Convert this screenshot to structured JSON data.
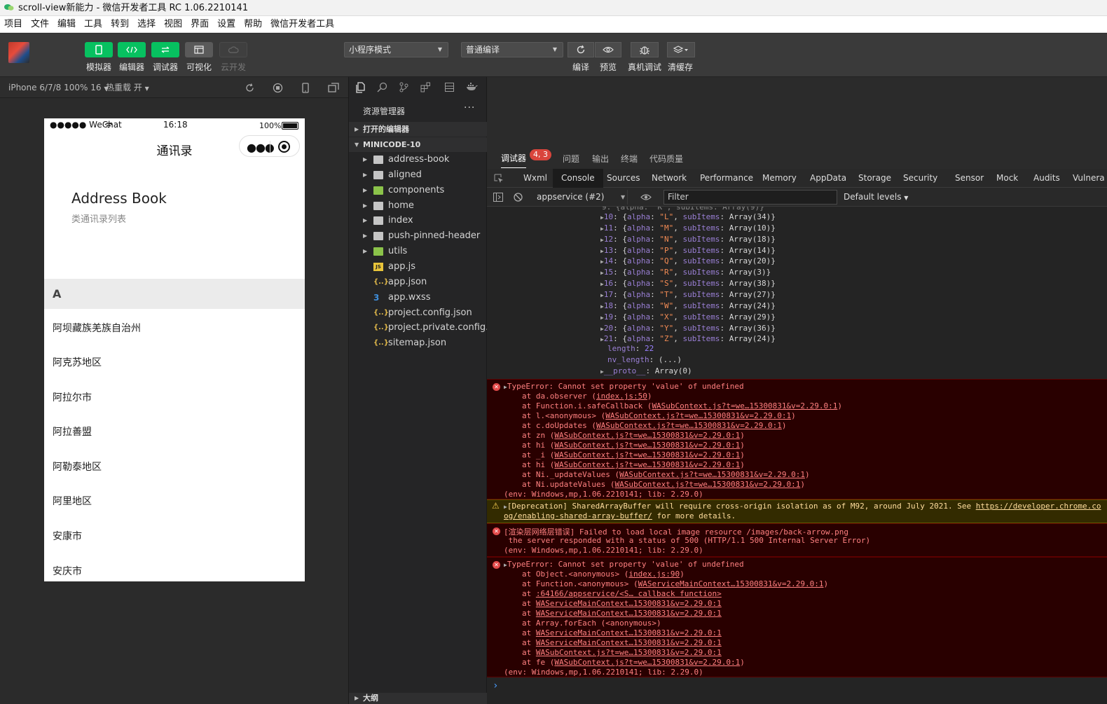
{
  "window": {
    "title": "scroll-view新能力 - 微信开发者工具 RC 1.06.2210141"
  },
  "menu": [
    "项目",
    "文件",
    "编辑",
    "工具",
    "转到",
    "选择",
    "视图",
    "界面",
    "设置",
    "帮助",
    "微信开发者工具"
  ],
  "toolbar": {
    "simulator": "模拟器",
    "editor": "编辑器",
    "debugger": "调试器",
    "visual": "可视化",
    "cloud": "云开发",
    "mode_select": "小程序模式",
    "compile_select": "普通编译",
    "compile": "编译",
    "preview": "预览",
    "real_debug": "真机调试",
    "clear_cache": "清缓存"
  },
  "simulator": {
    "device": "iPhone 6/7/8 100% 16",
    "hot_reload": "热重载 开",
    "status_left": "●●●●● WeChat",
    "time": "16:18",
    "battery": "100%",
    "nav_title": "通讯录",
    "big_title": "Address Book",
    "sub_title": "类通讯录列表",
    "alpha": "A",
    "cities": [
      "阿坝藏族羌族自治州",
      "阿克苏地区",
      "阿拉尔市",
      "阿拉善盟",
      "阿勒泰地区",
      "阿里地区",
      "安康市",
      "安庆市"
    ]
  },
  "explorer": {
    "title": "资源管理器",
    "more": "···",
    "open_editors": "打开的编辑器",
    "project": "MINICODE-10",
    "outline": "大纲",
    "items": [
      {
        "label": "address-book",
        "type": "folder",
        "arrow": true
      },
      {
        "label": "aligned",
        "type": "folder",
        "arrow": true
      },
      {
        "label": "components",
        "type": "folder-green",
        "arrow": true
      },
      {
        "label": "home",
        "type": "folder",
        "arrow": true
      },
      {
        "label": "index",
        "type": "folder",
        "arrow": true
      },
      {
        "label": "push-pinned-header",
        "type": "folder",
        "arrow": true
      },
      {
        "label": "utils",
        "type": "folder-green",
        "arrow": true
      },
      {
        "label": "app.js",
        "type": "js",
        "arrow": false
      },
      {
        "label": "app.json",
        "type": "json",
        "arrow": false
      },
      {
        "label": "app.wxss",
        "type": "css",
        "arrow": false
      },
      {
        "label": "project.config.json",
        "type": "json",
        "arrow": false
      },
      {
        "label": "project.private.config.js...",
        "type": "json",
        "arrow": false
      },
      {
        "label": "sitemap.json",
        "type": "json",
        "arrow": false
      }
    ]
  },
  "devtools": {
    "top_tabs": [
      "调试器",
      "问题",
      "输出",
      "终端",
      "代码质量"
    ],
    "badge": "4, 3",
    "tabs": [
      "Wxml",
      "Console",
      "Sources",
      "Network",
      "Performance",
      "Memory",
      "AppData",
      "Storage",
      "Security",
      "Sensor",
      "Mock",
      "Audits",
      "Vulnera"
    ],
    "context": "appservice (#2)",
    "filter_placeholder": "Filter",
    "levels": "Default levels",
    "array_items": [
      {
        "idx": "10",
        "alpha": "\"L\"",
        "sub": "Array(34)"
      },
      {
        "idx": "11",
        "alpha": "\"M\"",
        "sub": "Array(10)"
      },
      {
        "idx": "12",
        "alpha": "\"N\"",
        "sub": "Array(18)"
      },
      {
        "idx": "13",
        "alpha": "\"P\"",
        "sub": "Array(14)"
      },
      {
        "idx": "14",
        "alpha": "\"Q\"",
        "sub": "Array(20)"
      },
      {
        "idx": "15",
        "alpha": "\"R\"",
        "sub": "Array(3)"
      },
      {
        "idx": "16",
        "alpha": "\"S\"",
        "sub": "Array(38)"
      },
      {
        "idx": "17",
        "alpha": "\"T\"",
        "sub": "Array(27)"
      },
      {
        "idx": "18",
        "alpha": "\"W\"",
        "sub": "Array(24)"
      },
      {
        "idx": "19",
        "alpha": "\"X\"",
        "sub": "Array(29)"
      },
      {
        "idx": "20",
        "alpha": "\"Y\"",
        "sub": "Array(36)"
      },
      {
        "idx": "21",
        "alpha": "\"Z\"",
        "sub": "Array(24)"
      }
    ],
    "length_key": "length",
    "length_val": "22",
    "nv_key": "nv_length",
    "nv_val": "(...)",
    "proto_key": "__proto__",
    "proto_val": "Array(0)",
    "err1": {
      "head": "TypeError: Cannot set property 'value' of undefined",
      "frames": [
        [
          "at da.observer (",
          "index.js:50",
          ")"
        ],
        [
          "at Function.i.safeCallback (",
          "WASubContext.js?t=we…15300831&v=2.29.0:1",
          ")"
        ],
        [
          "at l.<anonymous> (",
          "WASubContext.js?t=we…15300831&v=2.29.0:1",
          ")"
        ],
        [
          "at c.doUpdates (",
          "WASubContext.js?t=we…15300831&v=2.29.0:1",
          ")"
        ],
        [
          "at zn (",
          "WASubContext.js?t=we…15300831&v=2.29.0:1",
          ")"
        ],
        [
          "at hi (",
          "WASubContext.js?t=we…15300831&v=2.29.0:1",
          ")"
        ],
        [
          "at _i (",
          "WASubContext.js?t=we…15300831&v=2.29.0:1",
          ")"
        ],
        [
          "at hi (",
          "WASubContext.js?t=we…15300831&v=2.29.0:1",
          ")"
        ],
        [
          "at Ni._updateValues (",
          "WASubContext.js?t=we…15300831&v=2.29.0:1",
          ")"
        ],
        [
          "at Ni.updateValues (",
          "WASubContext.js?t=we…15300831&v=2.29.0:1",
          ")"
        ]
      ],
      "env": "(env: Windows,mp,1.06.2210141; lib: 2.29.0)"
    },
    "warn": {
      "line1a": "[Deprecation] SharedArrayBuffer will require cross-origin isolation as of M92, around July 2021. See ",
      "line1link": "https://developer.chrome.co",
      "line2link": "og/enabling-shared-array-buffer/",
      "line2b": " for more details."
    },
    "err2": {
      "line1": "[渲染层网络层错误] Failed to load local image resource /images/back-arrow.png",
      "line2": " the server responded with a status of 500 (HTTP/1.1 500 Internal Server Error)",
      "env": "(env: Windows,mp,1.06.2210141; lib: 2.29.0)"
    },
    "err3": {
      "head": "TypeError: Cannot set property 'value' of undefined",
      "frames": [
        [
          "at Object.<anonymous> (",
          "index.js:90",
          ")"
        ],
        [
          "at Function.<anonymous> (",
          "WAServiceMainContext…15300831&v=2.29.0:1",
          ")"
        ],
        [
          "at ",
          ":64166/appservice/<S… callback function>",
          ""
        ],
        [
          "at ",
          "WAServiceMainContext…15300831&v=2.29.0:1",
          ""
        ],
        [
          "at ",
          "WAServiceMainContext…15300831&v=2.29.0:1",
          ""
        ],
        [
          "at Array.forEach (<anonymous>)",
          "",
          ""
        ],
        [
          "at ",
          "WAServiceMainContext…15300831&v=2.29.0:1",
          ""
        ],
        [
          "at ",
          "WAServiceMainContext…15300831&v=2.29.0:1",
          ""
        ],
        [
          "at ",
          "WASubContext.js?t=we…15300831&v=2.29.0:1",
          ""
        ],
        [
          "at fe (",
          "WASubContext.js?t=we…15300831&v=2.29.0:1",
          ")"
        ]
      ],
      "env": "(env: Windows,mp,1.06.2210141; lib: 2.29.0)"
    },
    "prompt": "›"
  }
}
